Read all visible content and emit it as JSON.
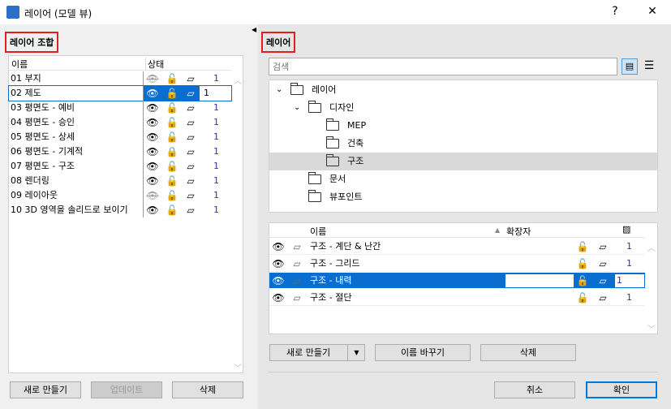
{
  "window": {
    "title": "레이어 (모델 뷰)",
    "help": "?",
    "close": "✕"
  },
  "left": {
    "section_title": "레이어 조합",
    "col_name": "이름",
    "col_status": "상태",
    "rows": [
      {
        "name": "01 부지",
        "visible": false,
        "locked": false,
        "num": "1"
      },
      {
        "name": "02 제도",
        "visible": true,
        "locked": false,
        "num": "1",
        "selected": true
      },
      {
        "name": "03 평면도 - 예비",
        "visible": true,
        "locked": false,
        "num": "1"
      },
      {
        "name": "04 평면도 - 승인",
        "visible": true,
        "locked": false,
        "num": "1"
      },
      {
        "name": "05 평면도 - 상세",
        "visible": true,
        "locked": false,
        "num": "1"
      },
      {
        "name": "06 평면도 - 기계적",
        "visible": true,
        "locked": true,
        "num": "1"
      },
      {
        "name": "07 평면도 - 구조",
        "visible": true,
        "locked": false,
        "num": "1"
      },
      {
        "name": "08 렌더링",
        "visible": true,
        "locked": false,
        "num": "1"
      },
      {
        "name": "09 레이아웃",
        "visible": false,
        "locked": false,
        "num": "1"
      },
      {
        "name": "10 3D 영역을 솔리드로 보이기",
        "visible": true,
        "locked": false,
        "num": "1"
      }
    ],
    "buttons": {
      "new": "새로 만들기",
      "update": "업데이트",
      "delete": "삭제"
    }
  },
  "right": {
    "section_title": "레이어",
    "search_placeholder": "검색",
    "tree": [
      {
        "label": "레이어",
        "level": 0,
        "expanded": true
      },
      {
        "label": "디자인",
        "level": 1,
        "expanded": true
      },
      {
        "label": "MEP",
        "level": 2
      },
      {
        "label": "건축",
        "level": 2
      },
      {
        "label": "구조",
        "level": 2,
        "selected": true
      },
      {
        "label": "문서",
        "level": 1
      },
      {
        "label": "뷰포인트",
        "level": 1
      }
    ],
    "table": {
      "col_name": "이름",
      "col_ext": "확장자",
      "rows": [
        {
          "name": "구조 - 계단 & 난간",
          "num": "1"
        },
        {
          "name": "구조 - 그리드",
          "num": "1"
        },
        {
          "name": "구조 - 내력",
          "num": "1",
          "selected": true
        },
        {
          "name": "구조 - 절단",
          "num": "1"
        }
      ]
    },
    "buttons": {
      "new": "새로 만들기",
      "rename": "이름 바꾸기",
      "delete": "삭제",
      "cancel": "취소",
      "ok": "확인"
    }
  }
}
